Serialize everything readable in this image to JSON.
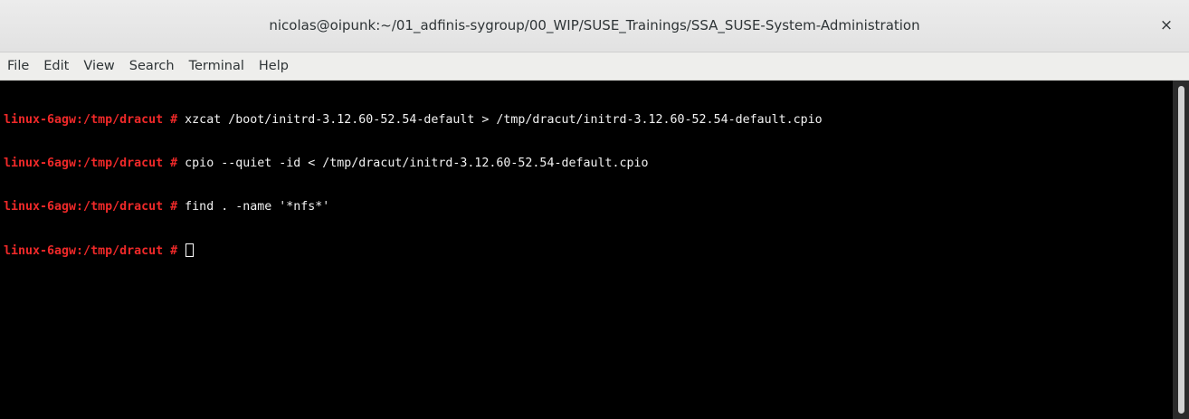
{
  "window": {
    "title": "nicolas@oipunk:~/01_adfinis-sygroup/00_WIP/SUSE_Trainings/SSA_SUSE-System-Administration",
    "close_glyph": "×"
  },
  "menu": {
    "items": [
      "File",
      "Edit",
      "View",
      "Search",
      "Terminal",
      "Help"
    ]
  },
  "terminal": {
    "prompt": "linux-6agw:/tmp/dracut",
    "hash": "#",
    "lines": [
      {
        "command": "xzcat /boot/initrd-3.12.60-52.54-default > /tmp/dracut/initrd-3.12.60-52.54-default.cpio"
      },
      {
        "command": "cpio --quiet -id < /tmp/dracut/initrd-3.12.60-52.54-default.cpio"
      },
      {
        "command": "find . -name '*nfs*'"
      },
      {
        "command": ""
      }
    ]
  },
  "colors": {
    "prompt": "#ef2929",
    "background": "#000000",
    "foreground": "#f2f2f2"
  }
}
